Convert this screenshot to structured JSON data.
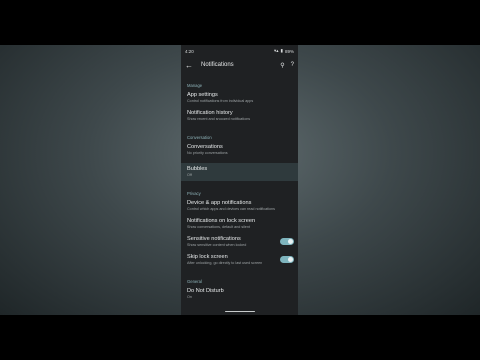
{
  "status_bar": {
    "time": "4:20",
    "battery": "89%"
  },
  "appbar": {
    "title": "Notifications"
  },
  "sections": {
    "manage": "Manage",
    "conversation": "Conversation",
    "privacy": "Privacy",
    "general": "General"
  },
  "items": {
    "app_settings": {
      "title": "App settings",
      "subtitle": "Control notifications from individual apps"
    },
    "notification_history": {
      "title": "Notification history",
      "subtitle": "Show recent and snoozed notifications"
    },
    "conversations": {
      "title": "Conversations",
      "subtitle": "No priority conversations"
    },
    "bubbles": {
      "title": "Bubbles",
      "subtitle": "Off"
    },
    "device_app_notifications": {
      "title": "Device & app notifications",
      "subtitle": "Control which apps and devices can read notifications"
    },
    "notifications_lock_screen": {
      "title": "Notifications on lock screen",
      "subtitle": "Show conversations, default and silent"
    },
    "sensitive_notifications": {
      "title": "Sensitive notifications",
      "subtitle": "Show sensitive content when locked",
      "enabled": true
    },
    "skip_lock_screen": {
      "title": "Skip lock screen",
      "subtitle": "After unlocking, go directly to last used screen",
      "enabled": true
    },
    "do_not_disturb": {
      "title": "Do Not Disturb",
      "subtitle": "On"
    }
  },
  "colors": {
    "accent": "#7eb4bd",
    "background": "#1f2123",
    "selected_row": "#2f3a3d"
  }
}
